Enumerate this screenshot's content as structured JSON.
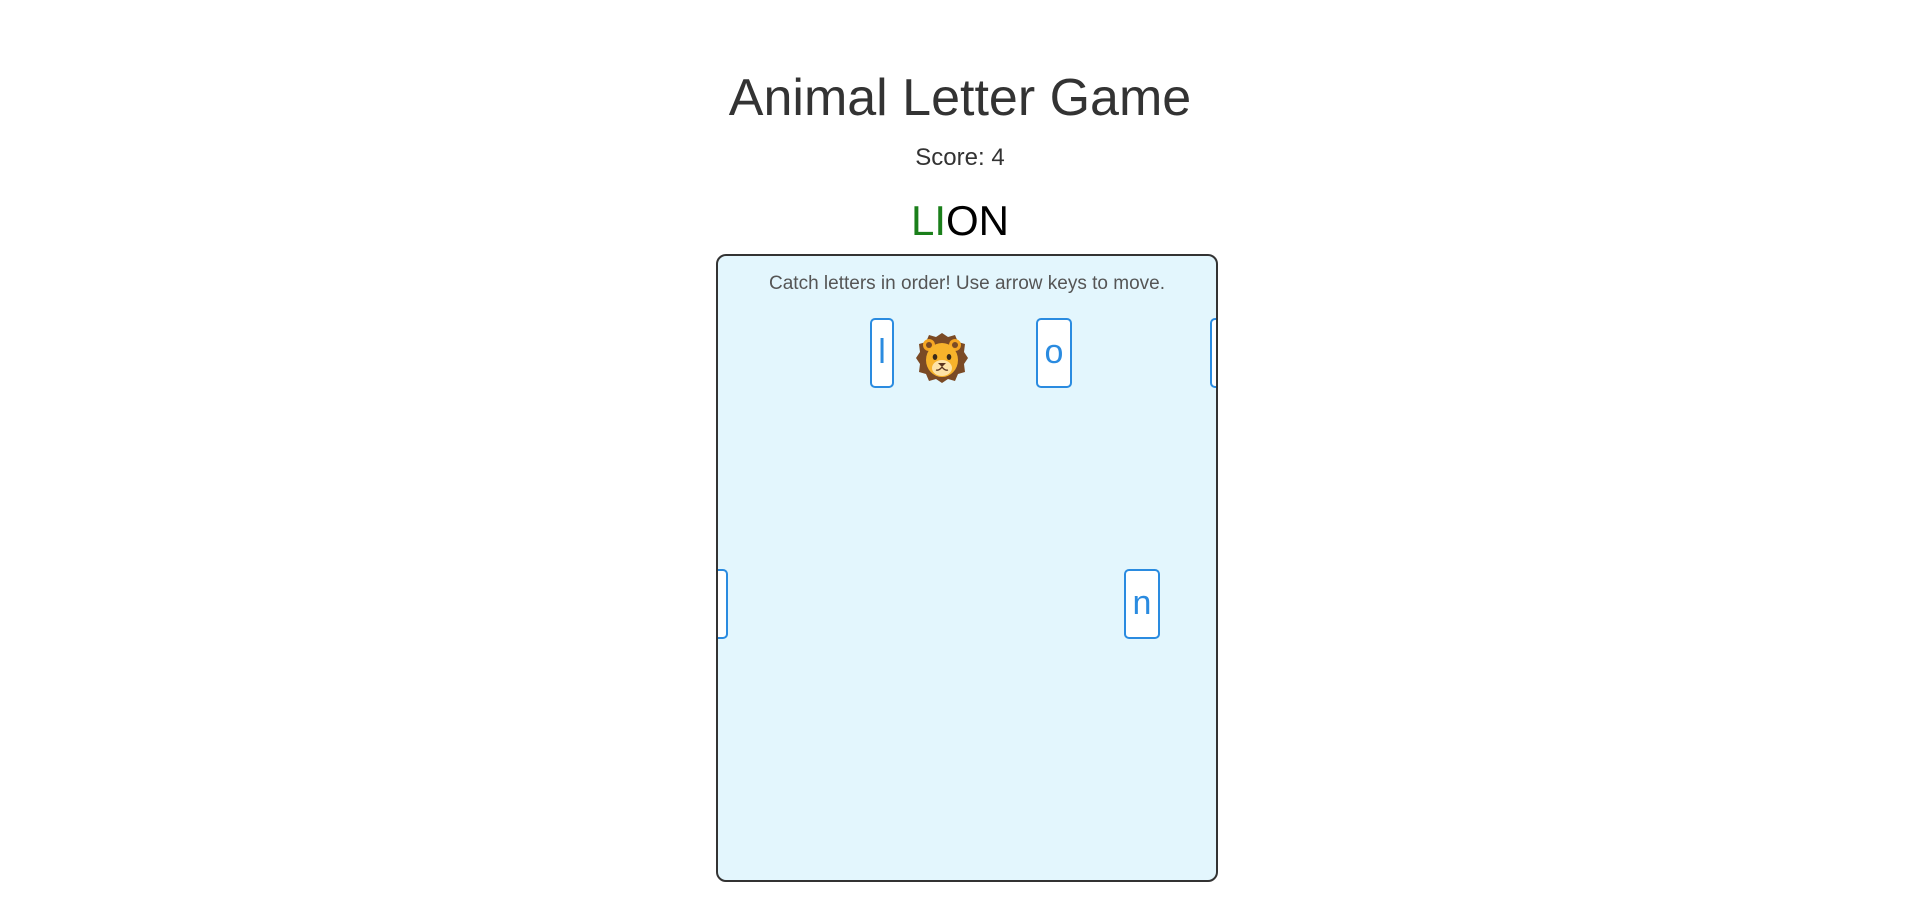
{
  "game": {
    "title": "Animal Letter Game",
    "score_label": "Score: 4",
    "target_word": {
      "caught": "LI",
      "pending": "ON"
    },
    "instructions": "Catch letters in order! Use arrow keys to move.",
    "player": {
      "animal": "lion-icon"
    },
    "falling_letters": [
      {
        "letter": "l"
      },
      {
        "letter": "o"
      },
      {
        "letter": ""
      },
      {
        "letter": ""
      },
      {
        "letter": "n"
      }
    ]
  },
  "colors": {
    "caught": "#1a7f1a",
    "pending": "#000000",
    "tile_border": "#2a8be0",
    "board_bg": "#e3f6fd"
  }
}
